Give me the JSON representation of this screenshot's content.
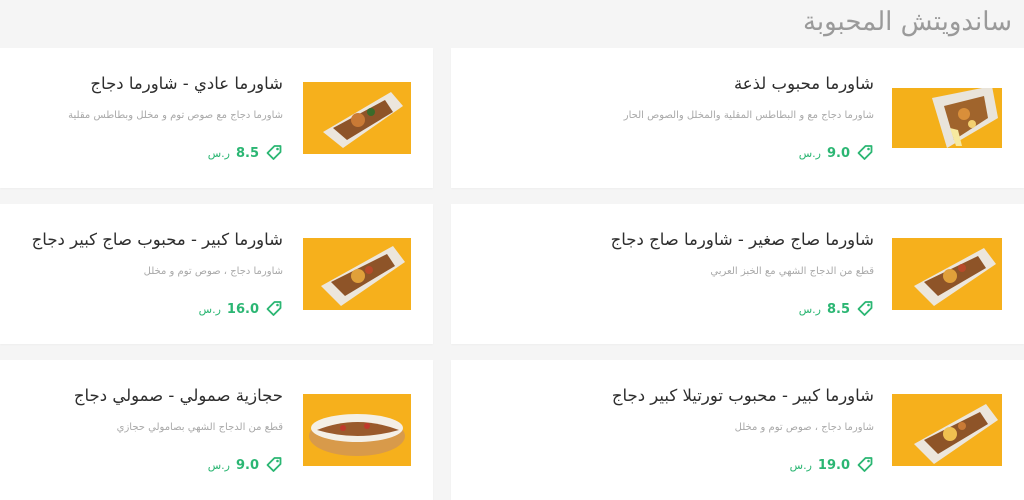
{
  "section": {
    "title": "ساندويتش المحبوبة"
  },
  "colors": {
    "accent": "#2bb673",
    "background": "#f5f5f5",
    "thumb_bg": "#f5b21a"
  },
  "icons": {
    "price": "price-tag-icon"
  },
  "items": [
    {
      "name": "شاورما محبوب لذعة",
      "desc": "شاورما دجاج مع و البطاطس المقلية والمخلل والصوص الحار",
      "price": "9.0",
      "currency": "ر.س",
      "image": "wrap-photo"
    },
    {
      "name": "شاورما عادي - شاورما دجاج",
      "desc": "شاورما دجاج مع صوص توم و مخلل وبطاطس مقلية",
      "price": "8.5",
      "currency": "ر.س",
      "image": "wrap-photo"
    },
    {
      "name": "شاورما صاج صغير - شاورما صاج دجاج",
      "desc": "قطع من الدجاج الشهي مع الخبز العربي",
      "price": "8.5",
      "currency": "ر.س",
      "image": "wrap-photo"
    },
    {
      "name": "شاورما كبير - محبوب صاج كبير دجاج",
      "desc": "شاورما دجاج ، صوص توم و مخلل",
      "price": "16.0",
      "currency": "ر.س",
      "image": "wrap-photo"
    },
    {
      "name": "شاورما كبير - محبوب تورتيلا كبير دجاج",
      "desc": "شاورما دجاج ، صوص توم و مخلل",
      "price": "19.0",
      "currency": "ر.س",
      "image": "wrap-photo"
    },
    {
      "name": "حجازية صمولي - صمولي دجاج",
      "desc": "قطع من الدجاج الشهي بصامولي حجازي",
      "price": "9.0",
      "currency": "ر.س",
      "image": "sub-photo"
    }
  ]
}
